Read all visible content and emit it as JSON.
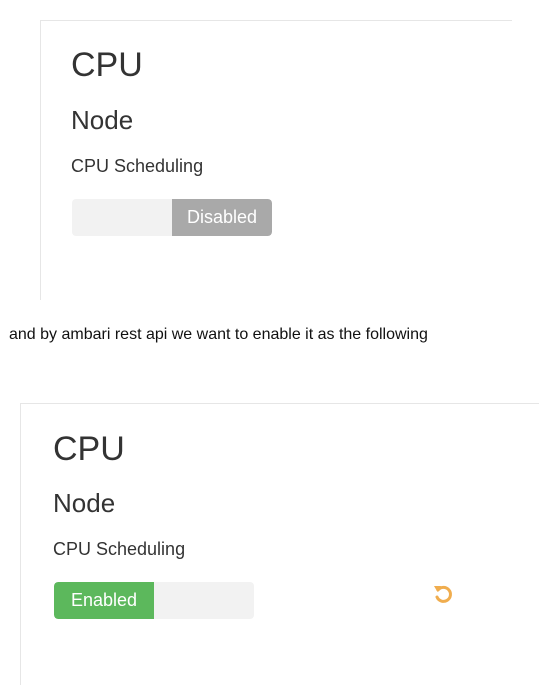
{
  "panel_top": {
    "title": "CPU",
    "section": "Node",
    "setting_label": "CPU Scheduling",
    "toggle_state": "Disabled",
    "toggle_value": false
  },
  "caption": "and by ambari rest api we want to enable it as the following",
  "panel_bottom": {
    "title": "CPU",
    "section": "Node",
    "setting_label": "CPU Scheduling",
    "toggle_state": "Enabled",
    "toggle_value": true,
    "undo_icon": "undo-icon"
  },
  "colors": {
    "enabled": "#5cb85c",
    "disabled": "#a9a9a9",
    "track": "#f2f2f2",
    "undo": "#f0ad4e"
  }
}
